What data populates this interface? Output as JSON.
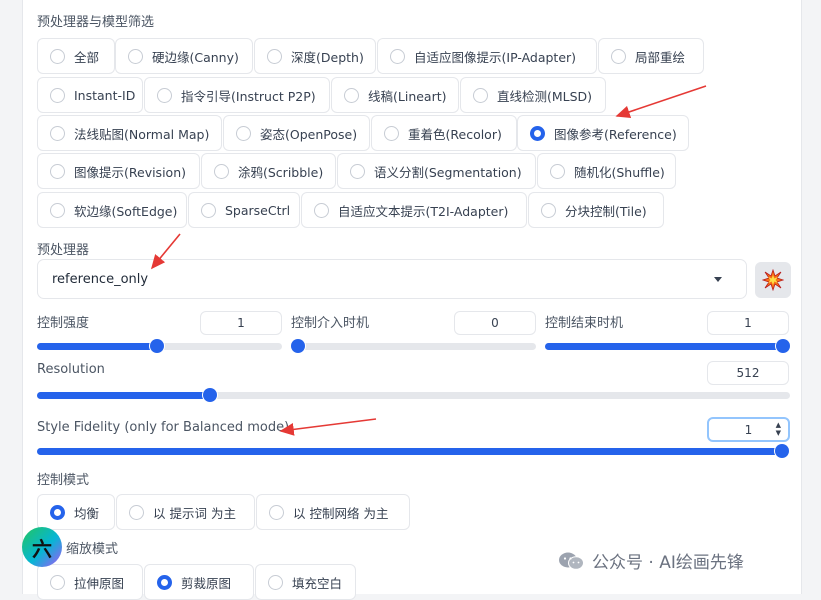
{
  "filter": {
    "title": "预处理器与模型筛选",
    "options": [
      {
        "label": "全部",
        "selected": false
      },
      {
        "label": "硬边缘(Canny)",
        "selected": false
      },
      {
        "label": "深度(Depth)",
        "selected": false
      },
      {
        "label": "自适应图像提示(IP-Adapter)",
        "selected": false
      },
      {
        "label": "局部重绘",
        "selected": false
      },
      {
        "label": "Instant-ID",
        "selected": false
      },
      {
        "label": "指令引导(Instruct P2P)",
        "selected": false
      },
      {
        "label": "线稿(Lineart)",
        "selected": false
      },
      {
        "label": "直线检测(MLSD)",
        "selected": false
      },
      {
        "label": "法线贴图(Normal Map)",
        "selected": false
      },
      {
        "label": "姿态(OpenPose)",
        "selected": false
      },
      {
        "label": "重着色(Recolor)",
        "selected": false
      },
      {
        "label": "图像参考(Reference)",
        "selected": true
      },
      {
        "label": "图像提示(Revision)",
        "selected": false
      },
      {
        "label": "涂鸦(Scribble)",
        "selected": false
      },
      {
        "label": "语义分割(Segmentation)",
        "selected": false
      },
      {
        "label": "随机化(Shuffle)",
        "selected": false
      },
      {
        "label": "软边缘(SoftEdge)",
        "selected": false
      },
      {
        "label": "SparseCtrl",
        "selected": false
      },
      {
        "label": "自适应文本提示(T2I-Adapter)",
        "selected": false
      },
      {
        "label": "分块控制(Tile)",
        "selected": false
      }
    ]
  },
  "preprocessor": {
    "title": "预处理器",
    "value": "reference_only",
    "run_icon": "explosion-icon"
  },
  "sliders": {
    "weight": {
      "label": "控制强度",
      "value": "1",
      "min": 0,
      "max": 2
    },
    "start": {
      "label": "控制介入时机",
      "value": "0",
      "min": 0,
      "max": 1
    },
    "end": {
      "label": "控制结束时机",
      "value": "1",
      "min": 0,
      "max": 1
    },
    "resolution": {
      "label": "Resolution",
      "value": "512",
      "min": 64,
      "max": 2048
    },
    "fidelity": {
      "label": "Style Fidelity (only for Balanced mode)",
      "value": "1",
      "min": 0,
      "max": 1
    }
  },
  "control_mode": {
    "title": "控制模式",
    "options": [
      {
        "label": "均衡",
        "selected": true
      },
      {
        "label": "以 提示词 为主",
        "selected": false
      },
      {
        "label": "以 控制网络 为主",
        "selected": false
      }
    ]
  },
  "resize_mode": {
    "title": "缩放模式",
    "options": [
      {
        "label": "拉伸原图",
        "selected": false
      },
      {
        "label": "剪裁原图",
        "selected": true
      },
      {
        "label": "填充空白",
        "selected": false
      }
    ]
  },
  "watermark": {
    "text": "公众号 · AI绘画先锋"
  },
  "colors": {
    "accent": "#2563eb",
    "annotation": "#e53935"
  }
}
